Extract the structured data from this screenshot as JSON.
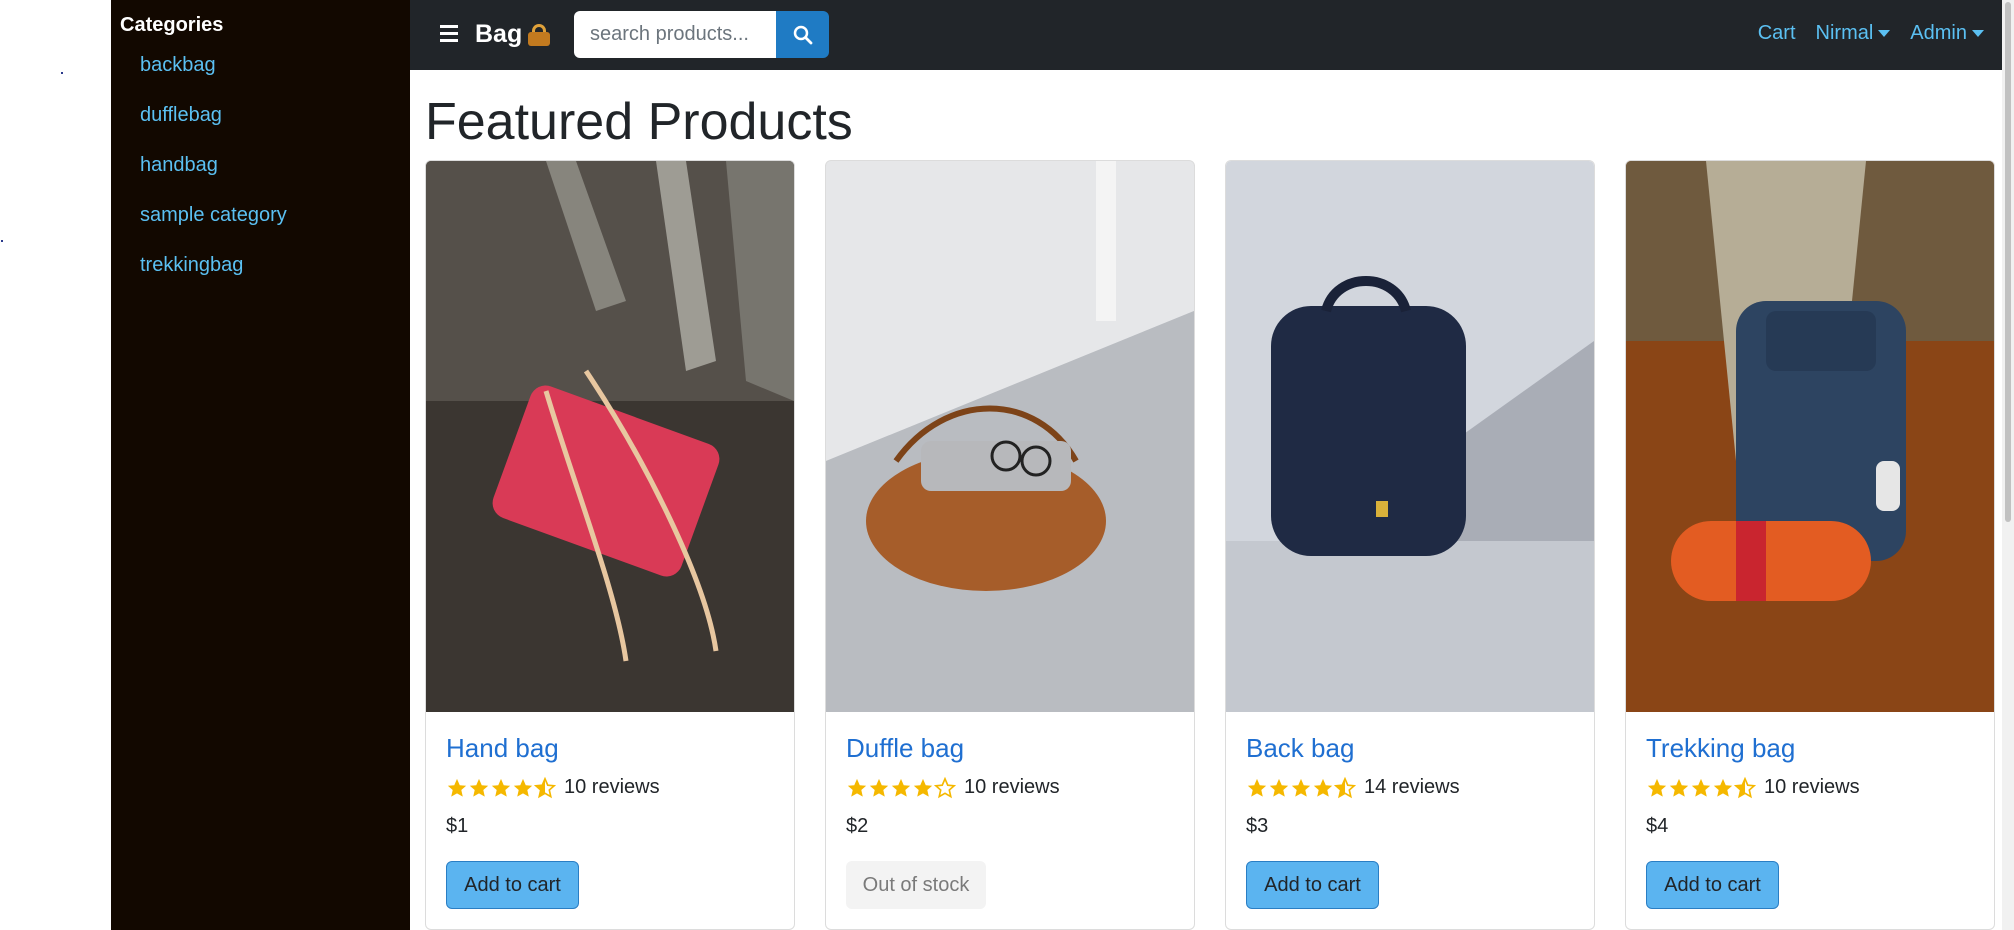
{
  "sidebar": {
    "title": "Categories",
    "items": [
      {
        "label": "backbag"
      },
      {
        "label": "dufflebag"
      },
      {
        "label": "handbag"
      },
      {
        "label": "sample category"
      },
      {
        "label": "trekkingbag"
      }
    ]
  },
  "navbar": {
    "brand": "Bag",
    "brand_icon": "handbag-icon",
    "search_placeholder": "search products...",
    "links": {
      "cart": "Cart",
      "user": "Nirmal",
      "admin": "Admin"
    },
    "accent_color": "#5bc0f2",
    "background_color": "#212529"
  },
  "main": {
    "title": "Featured Products",
    "products": [
      {
        "name": "Hand bag",
        "rating": 4.5,
        "reviews": "10 reviews",
        "price": "$1",
        "action": "Add to cart"
      },
      {
        "name": "Duffle bag",
        "rating": 4,
        "reviews": "10 reviews",
        "price": "$2",
        "action": "Out of stock"
      },
      {
        "name": "Back bag",
        "rating": 4.5,
        "reviews": "14 reviews",
        "price": "$3",
        "action": "Add to cart"
      },
      {
        "name": "Trekking bag",
        "rating": 4.5,
        "reviews": "10 reviews",
        "price": "$4",
        "action": "Add to cart"
      }
    ]
  }
}
